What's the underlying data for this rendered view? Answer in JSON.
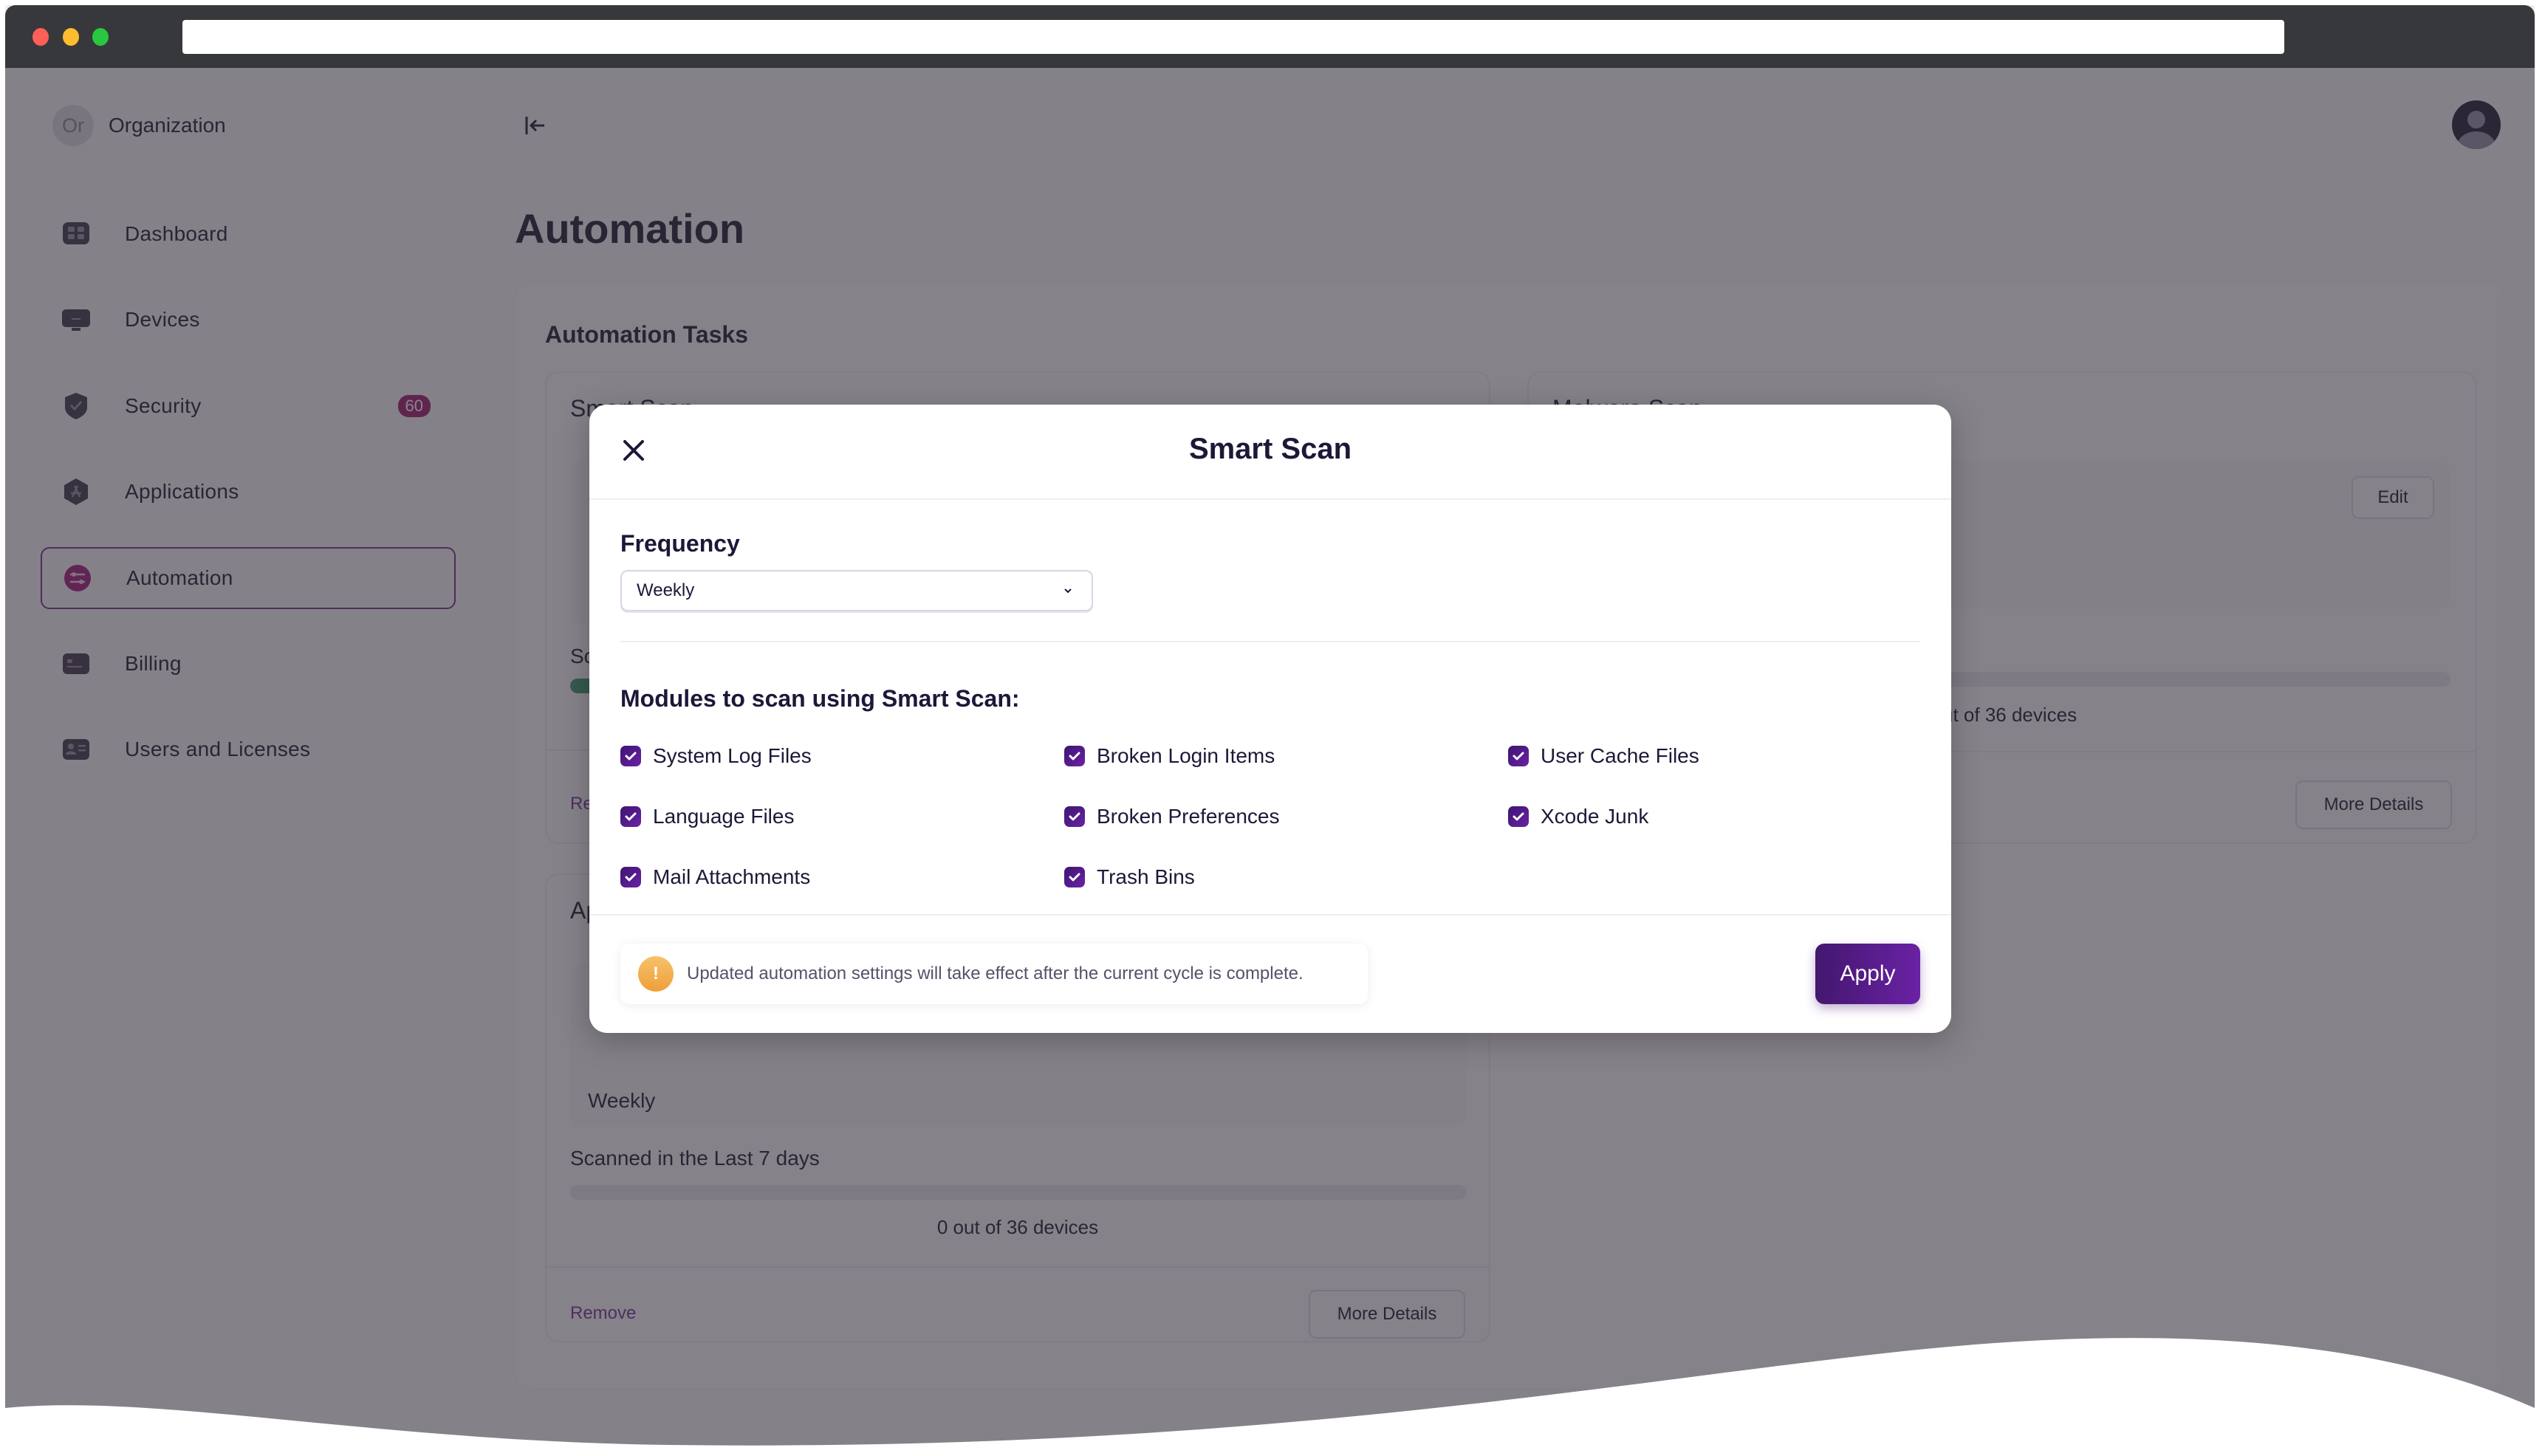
{
  "org": {
    "initials": "Or",
    "name": "Organization"
  },
  "sidebar": {
    "items": [
      {
        "label": "Dashboard",
        "icon": "dashboard-icon"
      },
      {
        "label": "Devices",
        "icon": "monitor-icon"
      },
      {
        "label": "Security",
        "icon": "shield-icon",
        "badge": "60"
      },
      {
        "label": "Applications",
        "icon": "app-store-icon"
      },
      {
        "label": "Automation",
        "icon": "sliders-icon",
        "active": true
      },
      {
        "label": "Billing",
        "icon": "credit-card-icon"
      },
      {
        "label": "Users and Licenses",
        "icon": "id-card-icon"
      }
    ]
  },
  "page": {
    "title": "Automation"
  },
  "tasks": {
    "title": "Automation Tasks",
    "cards": [
      {
        "title": "Smart Scan",
        "partial_label": "Sc",
        "progress_color": "#4a9e77",
        "remove_label": "Remove"
      },
      {
        "title": "Malware Scan",
        "edit_label": "Edit",
        "status_partial": "ut of 36 devices",
        "more_label": "More Details"
      },
      {
        "title_partial": "Ap",
        "frequency_partial": "Weekly",
        "scanned_label": "Scanned in the Last 7 days",
        "scanned_value": 0,
        "scanned_total": 36,
        "scanned_text": "0 out of 36 devices",
        "remove_label": "Remove",
        "more_label": "More Details"
      }
    ]
  },
  "modal": {
    "title": "Smart Scan",
    "frequency_label": "Frequency",
    "frequency_value": "Weekly",
    "modules_label": "Modules to scan using Smart Scan:",
    "modules": [
      {
        "label": "System Log Files",
        "checked": true
      },
      {
        "label": "Broken Login Items",
        "checked": true
      },
      {
        "label": "User Cache Files",
        "checked": true
      },
      {
        "label": "Language Files",
        "checked": true
      },
      {
        "label": "Broken Preferences",
        "checked": true
      },
      {
        "label": "Xcode Junk",
        "checked": true
      },
      {
        "label": "Mail Attachments",
        "checked": true
      },
      {
        "label": "Trash Bins",
        "checked": true
      }
    ],
    "notice": "Updated automation settings will take effect after the current cycle is complete.",
    "notice_icon": "!",
    "apply_label": "Apply"
  },
  "colors": {
    "accent": "#6a22a4",
    "accent_dark": "#43176f",
    "warning": "#ef9f3a",
    "badge": "#a22a73",
    "success": "#4a9e77"
  }
}
